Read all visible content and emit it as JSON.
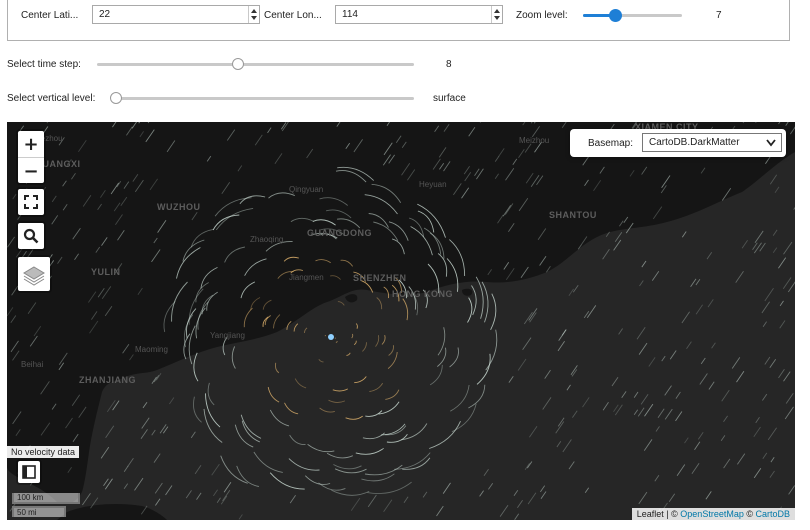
{
  "controls": {
    "center_lat_label": "Center Lati...",
    "center_lat_value": "22",
    "center_lon_label": "Center Lon...",
    "center_lon_value": "114",
    "zoom_label": "Zoom level:",
    "zoom_value": "7",
    "zoom_fraction": 0.3,
    "time_label": "Select time step:",
    "time_value": "8",
    "time_fraction": 0.45,
    "level_label": "Select vertical level:",
    "level_value": "surface",
    "level_fraction": 0.0
  },
  "map": {
    "zoom_in": "+",
    "zoom_out": "−",
    "basemap_label": "Basemap:",
    "basemap_value": "CartoDB.DarkMatter",
    "no_velocity": "No velocity data",
    "scale_km": "100 km",
    "scale_mi": "50 mi",
    "attribution": {
      "leaflet": "Leaflet",
      "sep1": " | © ",
      "osm": "OpenStreetMap",
      "sep2": " © ",
      "carto": "CartoDB"
    },
    "labels": {
      "guangdong": "GUANGDONG",
      "wuzhou": "WUZHOU",
      "yulin": "YULIN",
      "shantou": "SHANTOU",
      "xiamen": "XIAMEN CITY",
      "zhanjiang": "ZHANJIANG",
      "shenzhen": "SHENZHEN",
      "hongkong": "HONG KONG",
      "meizhou": "Meizhou",
      "heyuan": "Heyuan",
      "qingyuan": "Qingyuan",
      "zhaoqing": "Zhaoqing",
      "jiangmen": "Jiangmen",
      "yangjiang": "Yangjiang",
      "maoming": "Maoming",
      "hezhou": "Hezhou",
      "guangxi": "GUANGXI",
      "beihai": "Beihai"
    },
    "colors": {
      "background": "#262626",
      "land": "#151515",
      "particles": "#cfe0d8",
      "vortex": "#e6b870",
      "accent": "#1e7fd6"
    }
  }
}
